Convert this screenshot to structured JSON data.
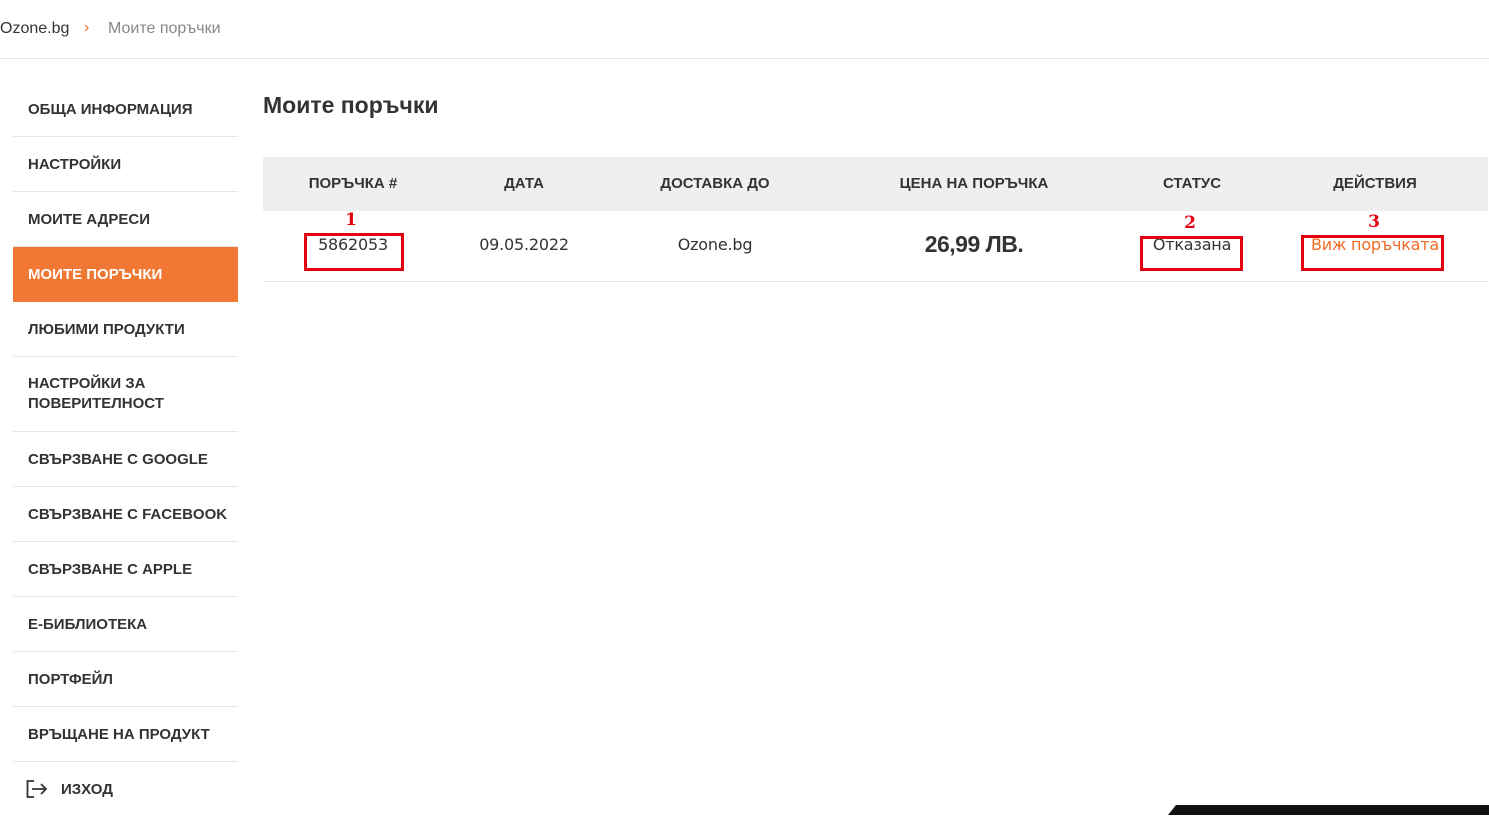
{
  "breadcrumb": {
    "home": "Ozone.bg",
    "separator": "›",
    "current": "Моите поръчки"
  },
  "sidebar": {
    "items": [
      {
        "label": "ОБЩА ИНФОРМАЦИЯ"
      },
      {
        "label": "НАСТРОЙКИ"
      },
      {
        "label": "МОИТЕ АДРЕСИ"
      },
      {
        "label": "МОИТЕ ПОРЪЧКИ",
        "active": true
      },
      {
        "label": "ЛЮБИМИ ПРОДУКТИ"
      },
      {
        "label": "НАСТРОЙКИ ЗА ПОВЕРИТЕЛНОСТ"
      },
      {
        "label": "СВЪРЗВАНЕ С GOOGLE"
      },
      {
        "label": "СВЪРЗВАНЕ С FACEBOOK"
      },
      {
        "label": "СВЪРЗВАНЕ С APPLE"
      },
      {
        "label": "Е-БИБЛИОТЕКА"
      },
      {
        "label": "ПОРТФЕЙЛ"
      },
      {
        "label": "ВРЪЩАНЕ НА ПРОДУКТ"
      }
    ],
    "logout": {
      "label": "ИЗХОД",
      "icon": "logout-icon"
    }
  },
  "main": {
    "title": "Моите поръчки",
    "table": {
      "headers": [
        "ПОРЪЧКА #",
        "ДАТА",
        "ДОСТАВКА ДО",
        "ЦЕНА НА ПОРЪЧКА",
        "СТАТУС",
        "ДЕЙСТВИЯ"
      ],
      "rows": [
        {
          "order": "5862053",
          "date": "09.05.2022",
          "delivery": "Ozone.bg",
          "price": "26,99 ЛВ.",
          "status": "Отказана",
          "action": "Виж поръчката"
        }
      ]
    }
  },
  "annotations": [
    "1",
    "2",
    "3"
  ],
  "colors": {
    "accent": "#f07834",
    "link": "#f26b24",
    "annotation": "#e3000f",
    "header_bg": "#efefef"
  }
}
